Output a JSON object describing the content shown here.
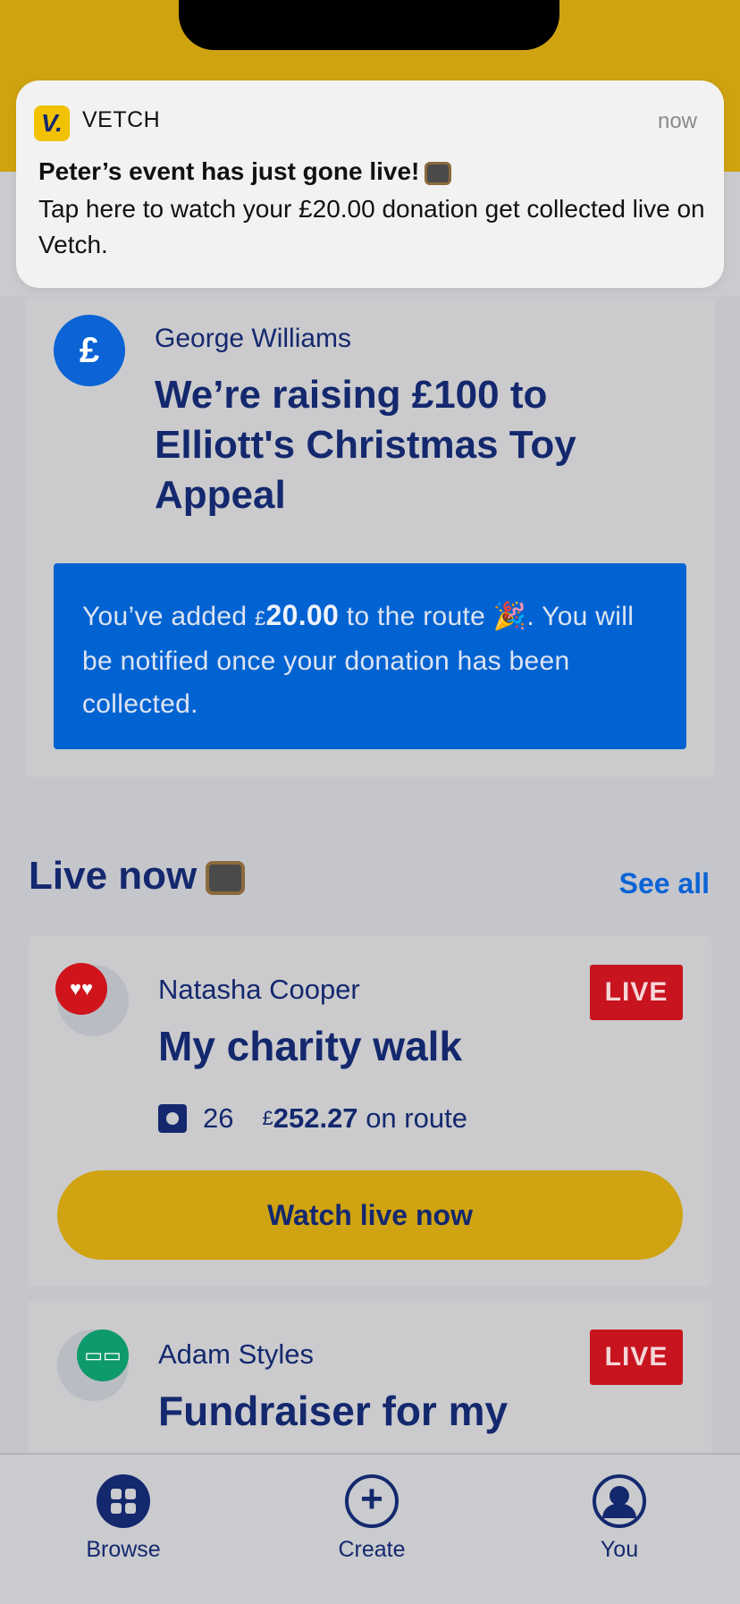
{
  "notification": {
    "app_icon_letter": "V.",
    "app_name": "VETCH",
    "time": "now",
    "title": "Peter’s event has just gone live!",
    "body": "Tap here to watch your £20.00 donation get collected live on Vetch."
  },
  "donation_card": {
    "avatar_symbol": "£",
    "name": "George Williams",
    "title": "We’re raising £100 to Elliott's Christmas Toy Appeal",
    "banner": {
      "prefix": "You’ve added",
      "currency": "£",
      "amount": "20.00",
      "suffix": "to the route 🎉.",
      "line2": "You will be notified once your donation has been collected."
    }
  },
  "live_now": {
    "title": "Live now",
    "see_all": "See all",
    "items": [
      {
        "name": "Natasha Cooper",
        "title": "My charity walk",
        "badge": "LIVE",
        "viewers": "26",
        "currency": "£",
        "amount": "252.27",
        "amount_suffix": "on route",
        "button": "Watch live now"
      },
      {
        "name": "Adam Styles",
        "title": "Fundraiser for my",
        "badge": "LIVE"
      }
    ]
  },
  "tabs": [
    {
      "label": "Browse",
      "icon": "grid-icon"
    },
    {
      "label": "Create",
      "icon": "plus-icon"
    },
    {
      "label": "You",
      "icon": "person-icon"
    }
  ]
}
